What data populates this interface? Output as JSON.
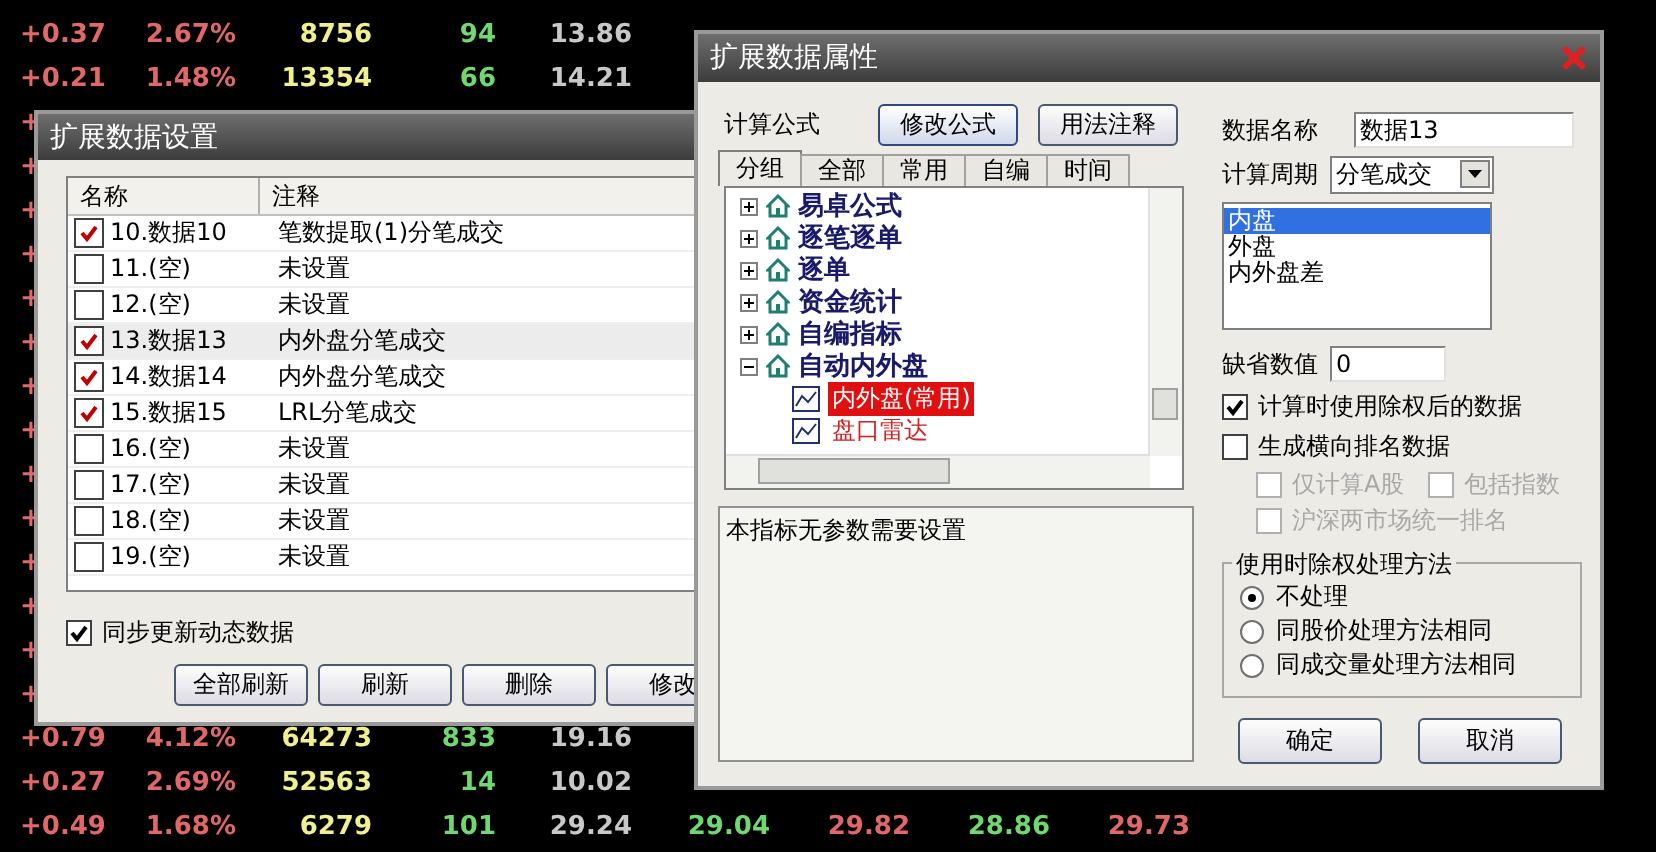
{
  "quote_table": {
    "rows": [
      {
        "cells": [
          {
            "text": "+0.37",
            "kind": "up"
          },
          {
            "text": "2.67%",
            "kind": "up"
          },
          {
            "text": "8756",
            "kind": "volume"
          },
          {
            "text": "94",
            "kind": "down"
          },
          {
            "text": "13.86",
            "kind": "flat"
          }
        ]
      },
      {
        "cells": [
          {
            "text": "+0.21",
            "kind": "up"
          },
          {
            "text": "1.48%",
            "kind": "up"
          },
          {
            "text": "13354",
            "kind": "volume"
          },
          {
            "text": "66",
            "kind": "down"
          },
          {
            "text": "14.21",
            "kind": "flat"
          }
        ]
      },
      {
        "cells": [
          {
            "text": "+",
            "kind": "up"
          }
        ]
      },
      {
        "cells": [
          {
            "text": "+",
            "kind": "up"
          }
        ]
      },
      {
        "cells": [
          {
            "text": "+",
            "kind": "up"
          }
        ]
      },
      {
        "cells": [
          {
            "text": "+",
            "kind": "up"
          }
        ]
      },
      {
        "cells": [
          {
            "text": "+",
            "kind": "up"
          }
        ]
      },
      {
        "cells": [
          {
            "text": "+",
            "kind": "up"
          }
        ]
      },
      {
        "cells": [
          {
            "text": "+",
            "kind": "up"
          }
        ]
      },
      {
        "cells": [
          {
            "text": "+",
            "kind": "up"
          }
        ]
      },
      {
        "cells": [
          {
            "text": "+",
            "kind": "up"
          }
        ]
      },
      {
        "cells": [
          {
            "text": "+",
            "kind": "up"
          }
        ]
      },
      {
        "cells": [
          {
            "text": "+",
            "kind": "up"
          }
        ]
      },
      {
        "cells": [
          {
            "text": "+",
            "kind": "up"
          }
        ]
      },
      {
        "cells": [
          {
            "text": "+",
            "kind": "up"
          }
        ]
      },
      {
        "cells": [
          {
            "text": "+",
            "kind": "up"
          }
        ]
      },
      {
        "cells": [
          {
            "text": "+0.79",
            "kind": "up"
          },
          {
            "text": "4.12%",
            "kind": "up"
          },
          {
            "text": "64273",
            "kind": "volume"
          },
          {
            "text": "833",
            "kind": "down"
          },
          {
            "text": "19.16",
            "kind": "flat"
          }
        ]
      },
      {
        "cells": [
          {
            "text": "+0.27",
            "kind": "up"
          },
          {
            "text": "2.69%",
            "kind": "up"
          },
          {
            "text": "52563",
            "kind": "volume"
          },
          {
            "text": "14",
            "kind": "down"
          },
          {
            "text": "10.02",
            "kind": "flat"
          }
        ]
      },
      {
        "cells": [
          {
            "text": "+0.49",
            "kind": "up"
          },
          {
            "text": "1.68%",
            "kind": "up"
          },
          {
            "text": "6279",
            "kind": "volume"
          },
          {
            "text": "101",
            "kind": "down"
          },
          {
            "text": "29.24",
            "kind": "flat"
          },
          {
            "text": "29.04",
            "kind": "down"
          },
          {
            "text": "29.82",
            "kind": "up"
          },
          {
            "text": "28.86",
            "kind": "down"
          },
          {
            "text": "29.73",
            "kind": "up"
          }
        ]
      }
    ]
  },
  "data_settings_dialog": {
    "title": "扩展数据设置",
    "columns": [
      "名称",
      "注释"
    ],
    "rows": [
      {
        "name": "10.数据10",
        "note": "笔数提取(1)分笔成交",
        "checked": true,
        "selected": false
      },
      {
        "name": "11.(空)",
        "note": "未设置",
        "checked": false,
        "selected": false
      },
      {
        "name": "12.(空)",
        "note": "未设置",
        "checked": false,
        "selected": false
      },
      {
        "name": "13.数据13",
        "note": "内外盘分笔成交",
        "checked": true,
        "selected": true
      },
      {
        "name": "14.数据14",
        "note": "内外盘分笔成交",
        "checked": true,
        "selected": false
      },
      {
        "name": "15.数据15",
        "note": "LRL分笔成交",
        "checked": true,
        "selected": false
      },
      {
        "name": "16.(空)",
        "note": "未设置",
        "checked": false,
        "selected": false
      },
      {
        "name": "17.(空)",
        "note": "未设置",
        "checked": false,
        "selected": false
      },
      {
        "name": "18.(空)",
        "note": "未设置",
        "checked": false,
        "selected": false
      },
      {
        "name": "19.(空)",
        "note": "未设置",
        "checked": false,
        "selected": false
      }
    ],
    "sync_option": {
      "label": "同步更新动态数据",
      "checked": true
    },
    "buttons": [
      "全部刷新",
      "刷新",
      "删除",
      "修改"
    ]
  },
  "data_properties_dialog": {
    "title": "扩展数据属性",
    "formula_label": "计算公式",
    "formula_buttons": [
      "修改公式",
      "用法注释"
    ],
    "tabs": [
      {
        "label": "分组",
        "selected": true
      },
      {
        "label": "全部",
        "selected": false
      },
      {
        "label": "常用",
        "selected": false
      },
      {
        "label": "自编",
        "selected": false
      },
      {
        "label": "时间",
        "selected": false
      }
    ],
    "tree": [
      {
        "label": "易卓公式",
        "expanded": false
      },
      {
        "label": "逐笔逐单",
        "expanded": false
      },
      {
        "label": "逐单",
        "expanded": false
      },
      {
        "label": "资金统计",
        "expanded": false
      },
      {
        "label": "自编指标",
        "expanded": false
      },
      {
        "label": "自动内外盘",
        "expanded": true,
        "children": [
          {
            "label": "内外盘(常用)",
            "selected": true
          },
          {
            "label": "盘口雷达",
            "selected": false
          }
        ]
      }
    ],
    "description": "本指标无参数需要设置",
    "name_field": {
      "label": "数据名称",
      "value": "数据13"
    },
    "period_field": {
      "label": "计算周期",
      "value": "分笔成交"
    },
    "output_list": [
      {
        "label": "内盘",
        "selected": true
      },
      {
        "label": "外盘",
        "selected": false
      },
      {
        "label": "内外盘差",
        "selected": false
      }
    ],
    "default_field": {
      "label": "缺省数值",
      "value": "0"
    },
    "options": [
      {
        "label": "计算时使用除权后的数据",
        "checked": true,
        "disabled": false
      },
      {
        "label": "生成横向排名数据",
        "checked": false,
        "disabled": false
      }
    ],
    "sub_options": [
      [
        {
          "label": "仅计算A股",
          "checked": false,
          "disabled": true
        },
        {
          "label": "包括指数",
          "checked": false,
          "disabled": true
        }
      ],
      [
        {
          "label": "沪深两市场统一排名",
          "checked": false,
          "disabled": true
        }
      ]
    ],
    "adjust_group": {
      "title": "使用时除权处理方法",
      "choices": [
        {
          "label": "不处理",
          "selected": true
        },
        {
          "label": "同股价处理方法相同",
          "selected": false
        },
        {
          "label": "同成交量处理方法相同",
          "selected": false
        }
      ]
    },
    "buttons": [
      "确定",
      "取消"
    ]
  }
}
